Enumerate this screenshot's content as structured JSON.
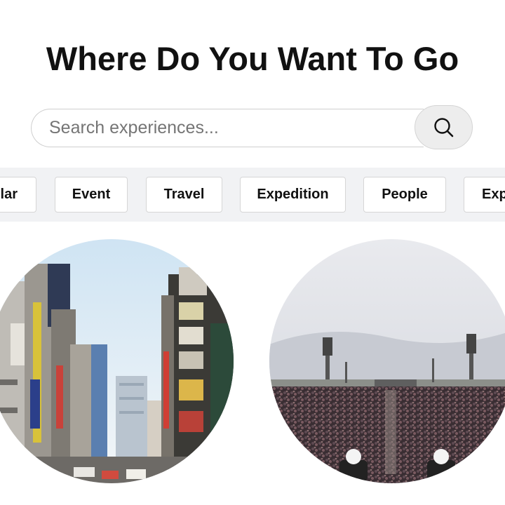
{
  "header": {
    "title": "Where Do You Want To Go"
  },
  "search": {
    "placeholder": "Search experiences...",
    "value": "",
    "button_icon": "search-icon"
  },
  "categories": {
    "items": [
      {
        "label": "ular"
      },
      {
        "label": "Event"
      },
      {
        "label": "Travel"
      },
      {
        "label": "Expedition"
      },
      {
        "label": "People"
      },
      {
        "label": "Exp"
      }
    ]
  },
  "experiences": {
    "items": [
      {
        "image": "city-street-photo"
      },
      {
        "image": "concert-crowd-photo"
      }
    ]
  },
  "colors": {
    "chip_bar_bg": "#f1f2f4",
    "search_button_bg": "#ededed",
    "title_text": "#111111"
  }
}
